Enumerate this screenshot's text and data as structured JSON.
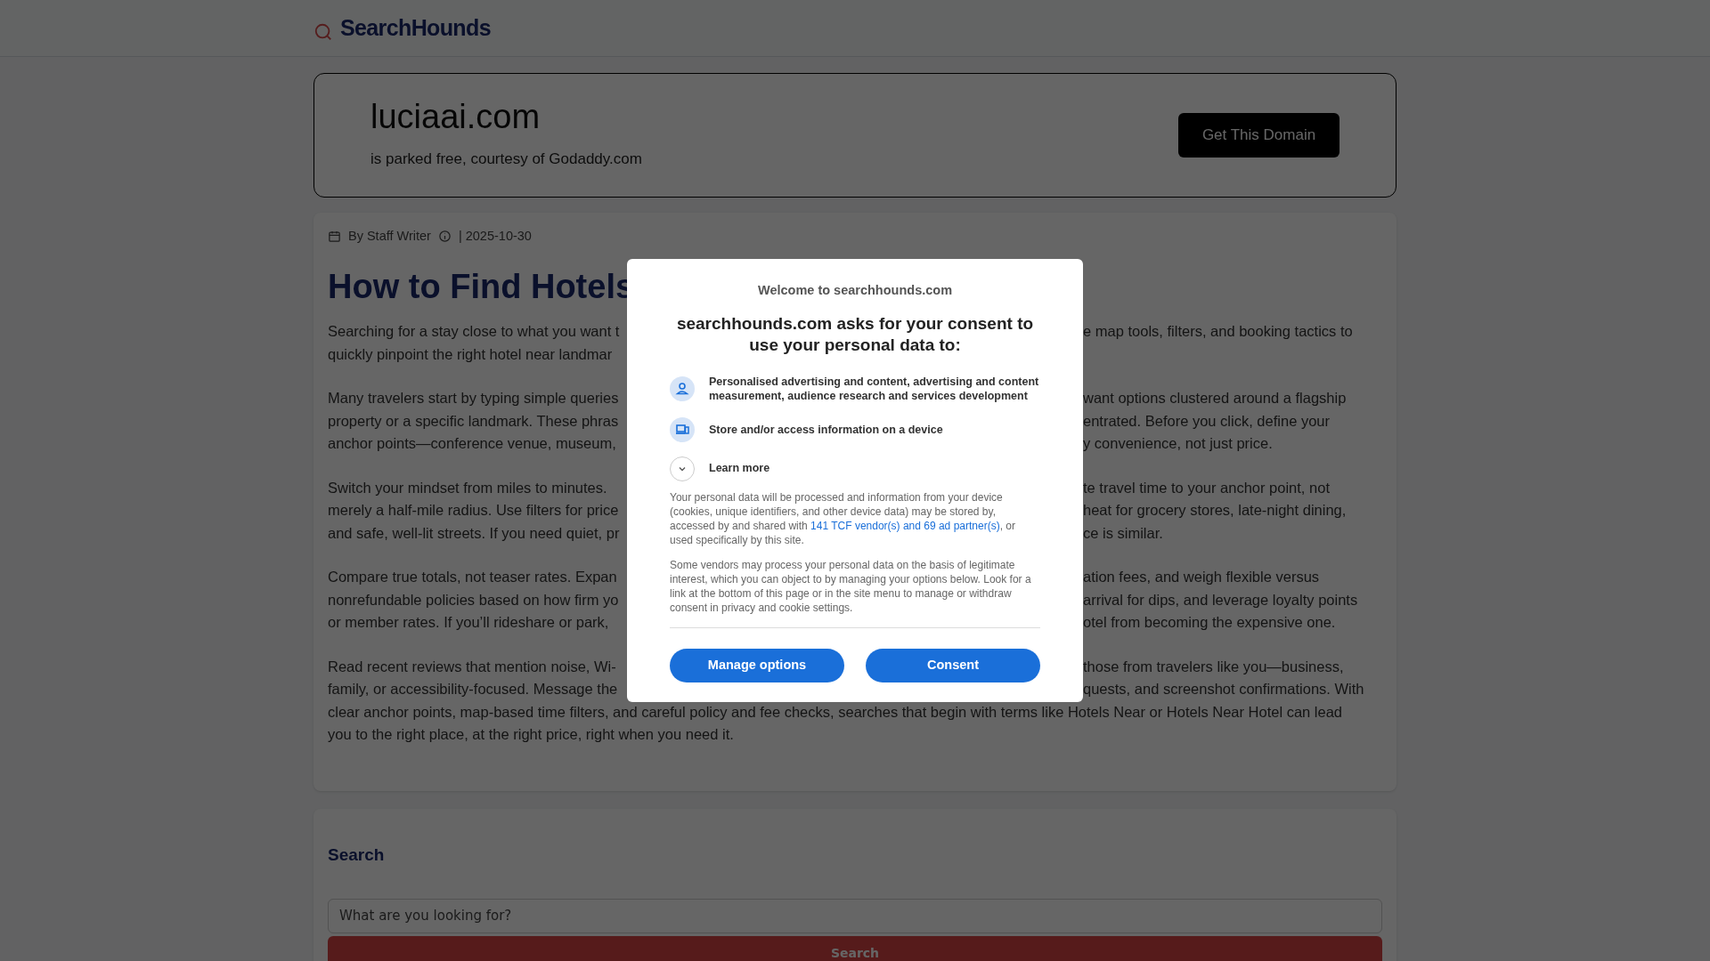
{
  "header": {
    "logo": "SearchHounds"
  },
  "domain_card": {
    "domain": "luciaai.com",
    "subtitle": "is parked free, courtesy of Godaddy.com",
    "button": "Get This Domain"
  },
  "article": {
    "author": "By Staff Writer",
    "date": "| 2025-10-30",
    "title": "How to Find Hotels",
    "paragraphs": [
      {
        "lines": [
          {
            "left": "Searching for a stay close to what you want t",
            "right": "e map tools, filters, and booking tactics to"
          },
          {
            "left": "quickly pinpoint the right hotel near landmar"
          }
        ]
      },
      {
        "lines": [
          {
            "left": "Many travelers start by typing simple queries",
            "right": "want options clustered around a flagship"
          },
          {
            "left": "property or a specific landmark. These phras",
            "right": "entrated. Before you click, define your"
          },
          {
            "left": "anchor points—conference venue, museum,",
            "right": "y convenience, not just price."
          }
        ]
      },
      {
        "lines": [
          {
            "left": "Switch your mindset from miles to minutes.",
            "right": "te travel time to your anchor point, not"
          },
          {
            "left": "merely a half-mile radius. Use filters for price",
            "right": "heat for grocery stores, late-night dining,"
          },
          {
            "left": "and safe, well-lit streets. If you need quiet, pr",
            "right": "ce is similar."
          }
        ]
      },
      {
        "lines": [
          {
            "left": "Compare true totals, not teaser rates. Expan",
            "right": "ation fees, and weigh flexible versus"
          },
          {
            "left": "nonrefundable policies based on how firm yo",
            "right": "arrival for dips, and leverage loyalty points"
          },
          {
            "left": "or member rates. If you’ll rideshare or park,",
            "right": "otel from becoming the expensive one."
          }
        ]
      },
      {
        "lines": [
          {
            "left": "Read recent reviews that mention noise, Wi-",
            "right": "those from travelers like you—business,"
          },
          {
            "left": "family, or accessibility-focused. Message the",
            "right": "quests, and screenshot confirmations. With"
          },
          {
            "full": "clear anchor points, map-based time filters, and careful policy and fee checks, searches that begin with terms like Hotels Near or Hotels Near Hotel can lead"
          },
          {
            "full": "you to the right place, at the right price, right when you need it."
          }
        ]
      }
    ]
  },
  "search_card": {
    "title": "Search",
    "placeholder": "What are you looking for?",
    "button": "Search"
  },
  "consent": {
    "welcome": "Welcome to searchhounds.com",
    "heading": "searchhounds.com asks for your consent to use your personal data to:",
    "purposes": [
      {
        "kind": "person",
        "text": "Personalised advertising and content, advertising and content measurement, audience research and services development"
      },
      {
        "kind": "device",
        "text": "Store and/or access information on a device"
      }
    ],
    "learn_more": {
      "label": "Learn more",
      "expanded": false
    },
    "body_before": "Your personal data will be processed and information from your device (cookies, unique identifiers, and other device data) may be stored by, accessed by and shared with ",
    "link": "141 TCF vendor(s) and 69 ad partner(s)",
    "body_after": ", or used specifically by this site.",
    "body2": "Some vendors may process your personal data on the basis of legitimate interest, which you can object to by managing your options below. Look for a link at the bottom of this page or in the site menu to manage or withdraw consent in privacy and cookie settings.",
    "buttons": [
      "Manage options",
      "Consent"
    ]
  }
}
